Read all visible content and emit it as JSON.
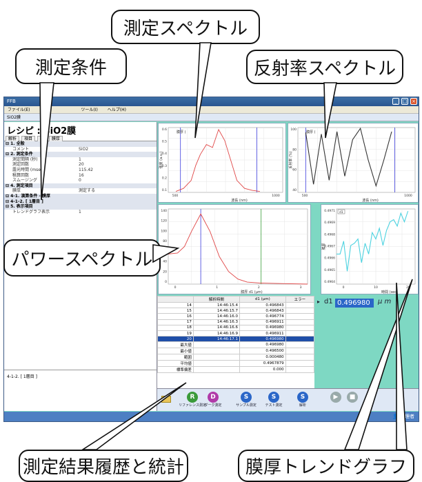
{
  "callouts": {
    "measurement_spectrum": "測定スペクトル",
    "measurement_conditions": "測定条件",
    "reflectance_spectrum": "反射率スペクトル",
    "power_spectrum": "パワースペクトル",
    "history_stats": "測定結果履歴と統計",
    "thickness_trend": "膜厚トレンドグラフ"
  },
  "app": {
    "title": "FFB",
    "menu": [
      "ファイル(E)",
      "ツール(I)",
      "ヘルプ(H)"
    ],
    "doc_tab": "SiO2膜",
    "status_user": "管理者",
    "colors": {
      "accent": "#2a66c8",
      "panel_bg": "#7ed8c3",
      "selected_row": "#1f4ea8"
    }
  },
  "left_panel": {
    "recipe_title": "レシピ : SiO2膜",
    "tabs": [
      "解析",
      "項目",
      "ク",
      "膜厚"
    ],
    "categories": [
      {
        "label": "1. 全般",
        "rows": [
          {
            "k": "コメント",
            "v": "SiO2"
          }
        ]
      },
      {
        "label": "2. 測定条件",
        "rows": [
          {
            "k": "測定間隔 (秒)",
            "v": "1"
          },
          {
            "k": "測定回数",
            "v": "20"
          },
          {
            "k": "露光時間 (msec)",
            "v": "115.42"
          },
          {
            "k": "積算回数",
            "v": "16"
          },
          {
            "k": "スムージング",
            "v": "0"
          }
        ]
      },
      {
        "label": "4. 測定項目",
        "rows": [
          {
            "k": "膜厚",
            "v": "測定する"
          }
        ]
      },
      {
        "label": "4-1. 演算条件 - 膜厚",
        "rows": []
      },
      {
        "label": "4-1-2. [ 1層目 ]",
        "rows": []
      },
      {
        "label": "5. 表示項目",
        "rows": [
          {
            "k": "トレンドグラフ表示",
            "v": "1"
          }
        ]
      }
    ],
    "footer": "4-1-2. [ 1層目 ]"
  },
  "charts": {
    "measurement": {
      "ylabel": "強度 (a.u.)",
      "xlabel": "波長 (nm)",
      "marker": "膜厚 (",
      "xticks": [
        "500",
        "1000"
      ],
      "yticks": [
        "0.6",
        "0.5",
        "0.4",
        "0.3",
        "0.2",
        "0.1"
      ]
    },
    "reflectance": {
      "ylabel": "反射率 (%)",
      "xlabel": "波長 (nm)",
      "marker": "膜厚 (",
      "xticks": [
        "500",
        "1000"
      ],
      "yticks": [
        "100",
        "80",
        "60",
        "40"
      ]
    },
    "power": {
      "ylabel": "",
      "xlabel": "膜厚 d1 (μm)",
      "xticks": [
        "0",
        "1",
        "2",
        "3"
      ],
      "yticks": [
        "140",
        "120",
        "100",
        "80",
        "60",
        "40",
        "20",
        "0"
      ]
    },
    "trend": {
      "ylabel": "膜厚",
      "xlabel": "時間 (sec)",
      "legend": "d1",
      "xticks": [
        "0",
        "10",
        "20"
      ],
      "yticks": [
        "0.4971",
        "0.4969",
        "0.4968",
        "0.4967",
        "0.4966",
        "0.4965",
        "0.4964"
      ]
    }
  },
  "chart_data": [
    {
      "type": "line",
      "title": "",
      "xlabel": "波長 (nm)",
      "ylabel": "強度 (a.u.)",
      "x": [
        400,
        450,
        500,
        530,
        560,
        600,
        640,
        680,
        720,
        760,
        800,
        850,
        900,
        950
      ],
      "series": [
        {
          "values": [
            0.01,
            0.04,
            0.12,
            0.27,
            0.38,
            0.48,
            0.45,
            0.63,
            0.52,
            0.32,
            0.12,
            0.04,
            0.02,
            0.01
          ]
        }
      ],
      "xlim": [
        350,
        1100
      ],
      "ylim": [
        0,
        0.65
      ]
    },
    {
      "type": "line",
      "title": "",
      "xlabel": "波長 (nm)",
      "ylabel": "反射率 (%)",
      "x": [
        400,
        450,
        500,
        550,
        600,
        650,
        700,
        750,
        800,
        850,
        900,
        950
      ],
      "series": [
        {
          "values": [
            94,
            30,
            92,
            35,
            95,
            40,
            85,
            99,
            60,
            28,
            60,
            95
          ]
        }
      ],
      "xlim": [
        350,
        1100
      ],
      "ylim": [
        20,
        100
      ]
    },
    {
      "type": "line",
      "title": "",
      "xlabel": "膜厚 d1 (μm)",
      "ylabel": "",
      "x": [
        0,
        0.2,
        0.35,
        0.5,
        0.7,
        0.9,
        1.1,
        1.3,
        1.5,
        1.7,
        2.0,
        2.5,
        3.0
      ],
      "series": [
        {
          "values": [
            60,
            62,
            75,
            105,
            140,
            105,
            55,
            25,
            10,
            4,
            2,
            1,
            0
          ]
        }
      ],
      "xlim": [
        0,
        3
      ],
      "ylim": [
        0,
        150
      ]
    },
    {
      "type": "line",
      "title": "",
      "xlabel": "時間 (sec)",
      "ylabel": "膜厚",
      "x": [
        0,
        1,
        2,
        3,
        4,
        5,
        6,
        7,
        8,
        9,
        10,
        11,
        12,
        13,
        14,
        15,
        16,
        17,
        18,
        19,
        20
      ],
      "series": [
        {
          "name": "d1",
          "values": [
            0.49668,
            0.49668,
            0.4968,
            0.49652,
            0.49676,
            0.49678,
            0.49682,
            0.4966,
            0.49678,
            0.49668,
            0.49688,
            0.49682,
            0.49692,
            0.49676,
            0.4969,
            0.49698,
            0.497,
            0.49694,
            0.49706,
            0.49698,
            0.49708
          ]
        }
      ],
      "xlim": [
        0,
        22
      ],
      "ylim": [
        0.4964,
        0.4971
      ]
    }
  ],
  "history": {
    "headers": [
      "",
      "解析時間",
      "d1 (μm)",
      "エラー"
    ],
    "rows": [
      {
        "n": "14",
        "t": "14:46:15.4",
        "d": "0.496843",
        "e": ""
      },
      {
        "n": "15",
        "t": "14:46:15.7",
        "d": "0.496843",
        "e": ""
      },
      {
        "n": "16",
        "t": "14:46:16.0",
        "d": "0.496774",
        "e": ""
      },
      {
        "n": "17",
        "t": "14:46:16.3",
        "d": "0.496911",
        "e": ""
      },
      {
        "n": "18",
        "t": "14:46:16.6",
        "d": "0.496980",
        "e": ""
      },
      {
        "n": "19",
        "t": "14:46:16.9",
        "d": "0.496911",
        "e": ""
      },
      {
        "n": "20",
        "t": "14:46:17.1",
        "d": "0.496980",
        "e": ""
      }
    ],
    "stats": [
      {
        "k": "最大値",
        "v": "0.496980"
      },
      {
        "k": "最小値",
        "v": "0.496500"
      },
      {
        "k": "範囲",
        "v": "0.000480"
      },
      {
        "k": "平均値",
        "v": "0.4967879"
      },
      {
        "k": "標準偏差",
        "v": "0.000"
      }
    ]
  },
  "trend_value": {
    "label": "d1",
    "value": "0.496980",
    "unit": "μ m"
  },
  "toolbar": {
    "buttons": [
      {
        "label": "リファレンス測定",
        "glyph": "R",
        "color": "#3a9a3a"
      },
      {
        "label": "ダーク測定",
        "glyph": "D",
        "color": "#b03aa8"
      },
      {
        "label": "サンプル測定",
        "glyph": "S",
        "color": "#2a66c8"
      },
      {
        "label": "テスト測定",
        "glyph": "S",
        "color": "#2a66c8"
      },
      {
        "label": "解析",
        "glyph": "S",
        "color": "#2a66c8"
      },
      {
        "label": "",
        "glyph": "▶",
        "color": "#9aa"
      },
      {
        "label": "",
        "glyph": "■",
        "color": "#9aa"
      }
    ]
  }
}
